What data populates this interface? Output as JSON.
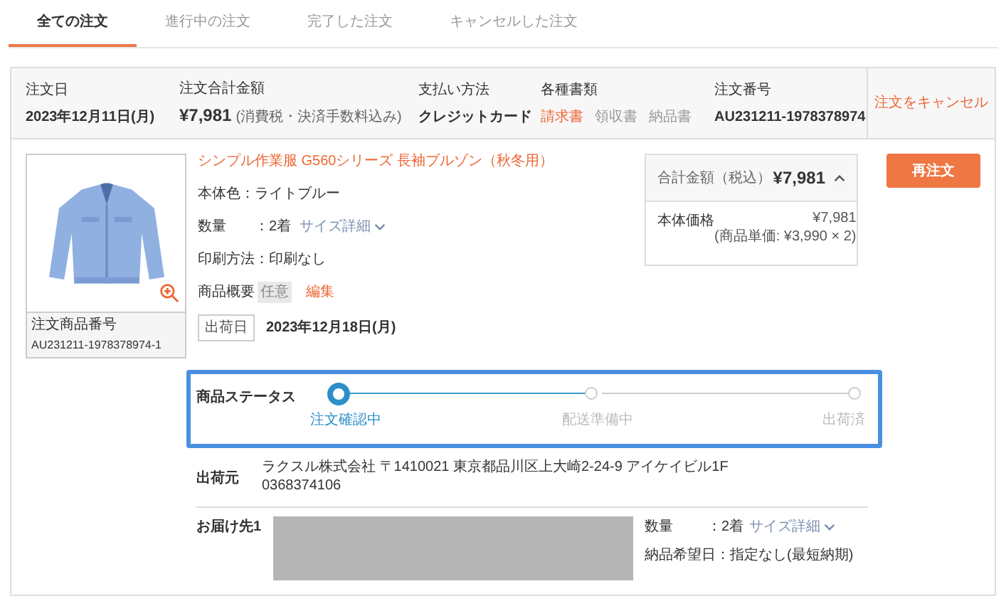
{
  "tabs": [
    {
      "label": "全ての注文",
      "selected": true
    },
    {
      "label": "進行中の注文",
      "selected": false
    },
    {
      "label": "完了した注文",
      "selected": false
    },
    {
      "label": "キャンセルした注文",
      "selected": false
    }
  ],
  "order_summary": {
    "date": {
      "label": "注文日",
      "value": "2023年12月11日(月)"
    },
    "total": {
      "label": "注文合計金額",
      "value": "¥7,981",
      "note": "(消費税・決済手数料込み)"
    },
    "payment": {
      "label": "支払い方法",
      "value": "クレジットカード"
    },
    "documents": {
      "label": "各種書類",
      "links": [
        {
          "label": "請求書",
          "active": true
        },
        {
          "label": "領収書",
          "active": false
        },
        {
          "label": "納品書",
          "active": false
        }
      ]
    },
    "order_number": {
      "label": "注文番号",
      "value": "AU231211-1978378974"
    },
    "cancel_link": "注文をキャンセル"
  },
  "product": {
    "title": "シンプル作業服 G560シリーズ 長袖ブルゾン（秋冬用）",
    "color": {
      "label": "本体色",
      "value": "：ライトブルー"
    },
    "quantity": {
      "label": "数量",
      "value": "：2着",
      "link": "サイズ詳細"
    },
    "print": {
      "label": "印刷方法",
      "value": "：印刷なし"
    },
    "summary": {
      "label": "商品概要",
      "tag": "任意",
      "link": "編集"
    },
    "ship_date": {
      "label": "出荷日",
      "value": "2023年12月18日(月)"
    },
    "image_caption": {
      "label": "注文商品番号",
      "value": "AU231211-1978378974-1"
    },
    "price_box": {
      "label": "合計金額（税込）",
      "amount": "¥7,981",
      "expanded": true,
      "line_label": "本体価格",
      "line_value": "¥7,981",
      "line_note": "(商品単価: ¥3,990 × 2)"
    },
    "reorder_button": "再注文"
  },
  "status": {
    "label": "商品ステータス",
    "steps": [
      {
        "label": "注文確認中",
        "selected": true
      },
      {
        "label": "配送準備中",
        "selected": false
      },
      {
        "label": "出荷済",
        "selected": false
      }
    ]
  },
  "shipper": {
    "label": "出荷元",
    "address": "ラクスル株式会社 〒1410021 東京都品川区上大崎2-24-9 アイケイビル1F",
    "phone": "0368374106"
  },
  "delivery": {
    "label": "お届け先1",
    "quantity_label": "数量",
    "quantity_value": "：2着",
    "quantity_link": "サイズ詳細",
    "date_label": "納品希望日",
    "date_value": "：指定なし(最短納期)"
  }
}
